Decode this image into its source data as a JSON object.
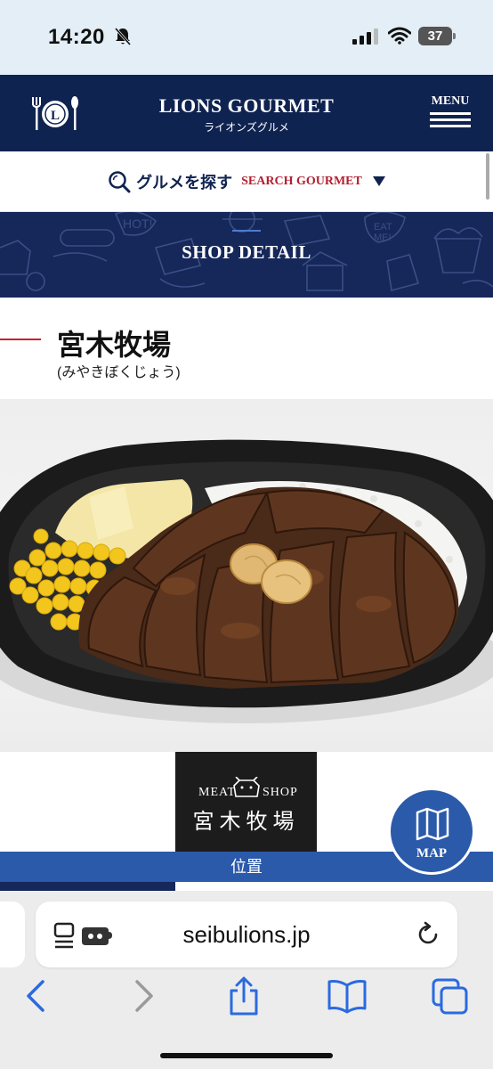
{
  "status_bar": {
    "time": "14:20",
    "battery": "37"
  },
  "header": {
    "brand_title": "LIONS GOURMET",
    "brand_subtitle": "ライオンズグルメ",
    "menu_label": "MENU"
  },
  "search": {
    "label_jp": "グルメを探す",
    "label_en": "SEARCH GOURMET"
  },
  "banner": {
    "title": "SHOP DETAIL"
  },
  "shop": {
    "name": "宮木牧場",
    "kana": "(みやきぼくじょう)",
    "logo_left": "MEAT",
    "logo_right": "SHOP",
    "logo_name": "宮木牧場"
  },
  "location": {
    "label": "位置"
  },
  "map_button": {
    "label": "MAP"
  },
  "browser": {
    "url": "seibulions.jp"
  },
  "colors": {
    "navy": "#0f2350",
    "accent_blue": "#2b5aaa",
    "red": "#b22030",
    "safari_blue": "#2a6ae0"
  }
}
